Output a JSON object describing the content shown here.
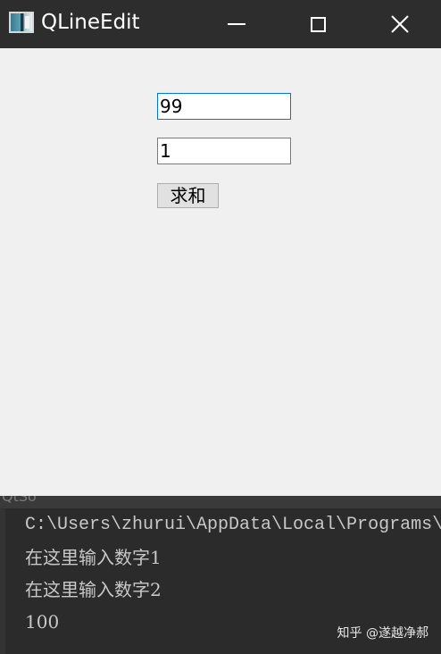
{
  "window": {
    "title": "QLineEdit",
    "icon": "app-window-icon",
    "controls": [
      "minimize-icon",
      "maximize-icon",
      "close-icon"
    ]
  },
  "form": {
    "input1_value": "99",
    "input2_value": "1",
    "sum_button_label": "求和"
  },
  "console": {
    "header_text": "QtSo",
    "lines": [
      "C:\\Users\\zhurui\\AppData\\Local\\Programs\\",
      "在这里输入数字1",
      "在这里输入数字2",
      "100"
    ]
  },
  "watermark": "知乎 @遂越净郝",
  "colors": {
    "titlebar": "#2d2d2d",
    "client_bg": "#f0f0f0",
    "console_bg": "#2b2b2b",
    "focus_border": "#0078d7"
  }
}
